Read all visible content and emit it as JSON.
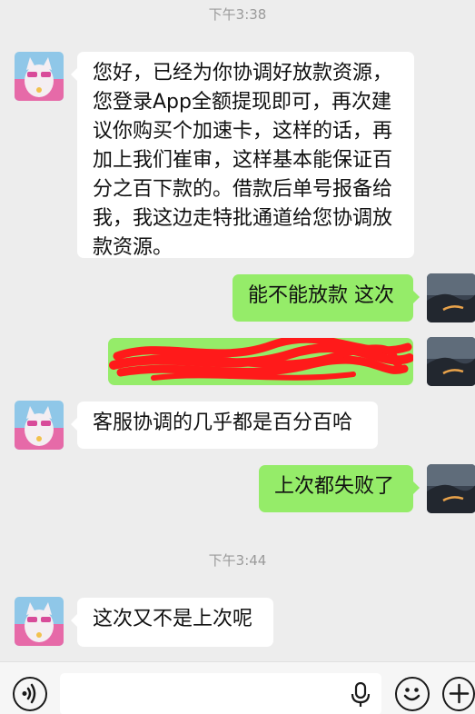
{
  "timestamps": [
    "下午3:38",
    "下午3:44"
  ],
  "messages": [
    {
      "direction": "in",
      "text": "您好，已经为你协调好放款资源，您登录App全额提现即可，再次建议你购买个加速卡，这样的话，再加上我们崔审，这样基本能保证百分之百下款的。借款后单号报备给我，我这边走特批通道给您协调放款资源。"
    },
    {
      "direction": "out",
      "text": "能不能放款 这次"
    },
    {
      "direction": "out",
      "text": "",
      "redacted": true
    },
    {
      "direction": "in",
      "text": "客服协调的几乎都是百分百哈"
    },
    {
      "direction": "out",
      "text": "上次都失败了"
    },
    {
      "direction": "in",
      "text": "这次又不是上次呢"
    }
  ],
  "icons": {
    "voice": "voice-icon",
    "mic": "microphone-icon",
    "emoji": "emoji-icon",
    "more": "plus-icon"
  },
  "colors": {
    "background": "#ededed",
    "incoming_bubble": "#ffffff",
    "outgoing_bubble": "#95ec69",
    "redaction": "#ff1a1a"
  }
}
